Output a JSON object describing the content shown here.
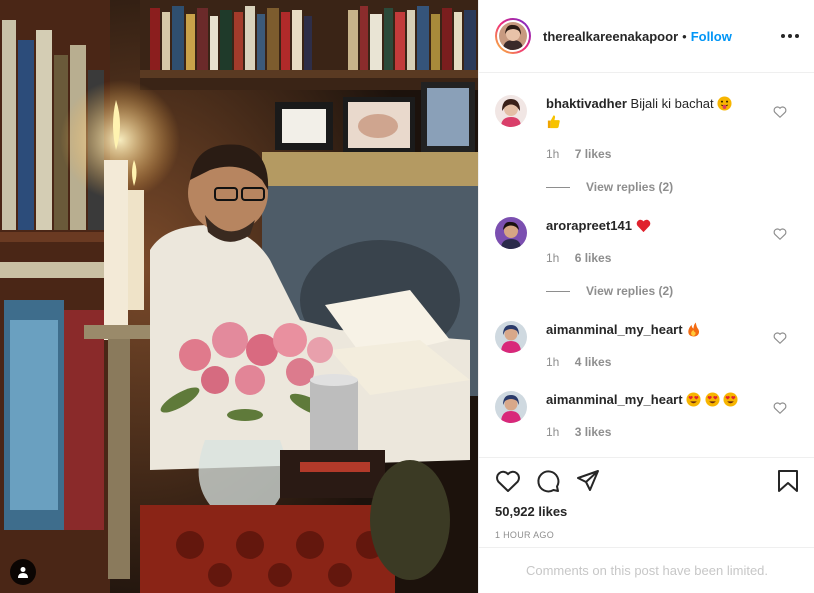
{
  "post": {
    "owner": "therealkareenakapoor",
    "separator": "•",
    "follow_label": "Follow",
    "more_icon": "more-dots-icon"
  },
  "comments": [
    {
      "user": "bhaktivadher",
      "text": "Bijali ki bachat",
      "emojis": [
        "tongue-face-emoji",
        "thumbs-up-emoji"
      ],
      "time": "1h",
      "likes": "7 likes",
      "view_replies": "View replies (2)"
    },
    {
      "user": "arorapreet141",
      "text": "",
      "emojis": [
        "red-heart-emoji"
      ],
      "time": "1h",
      "likes": "6 likes",
      "view_replies": "View replies (2)"
    },
    {
      "user": "aimanminal_my_heart",
      "text": "",
      "emojis": [
        "fire-emoji"
      ],
      "time": "1h",
      "likes": "4 likes"
    },
    {
      "user": "aimanminal_my_heart",
      "text": "",
      "emojis": [
        "heart-eyes-emoji",
        "heart-eyes-emoji",
        "heart-eyes-emoji"
      ],
      "time": "1h",
      "likes": "3 likes"
    }
  ],
  "actions": {
    "icons": [
      "heart-icon",
      "comment-icon",
      "share-icon",
      "bookmark-icon"
    ],
    "likes_count": "50,922 likes",
    "timestamp": "1 HOUR AGO"
  },
  "footer": {
    "limited_text": "Comments on this post have been limited."
  },
  "colors": {
    "follow_blue": "#0095f6",
    "muted_gray": "#8e8e8e",
    "text": "#262626",
    "border": "#efefef"
  }
}
